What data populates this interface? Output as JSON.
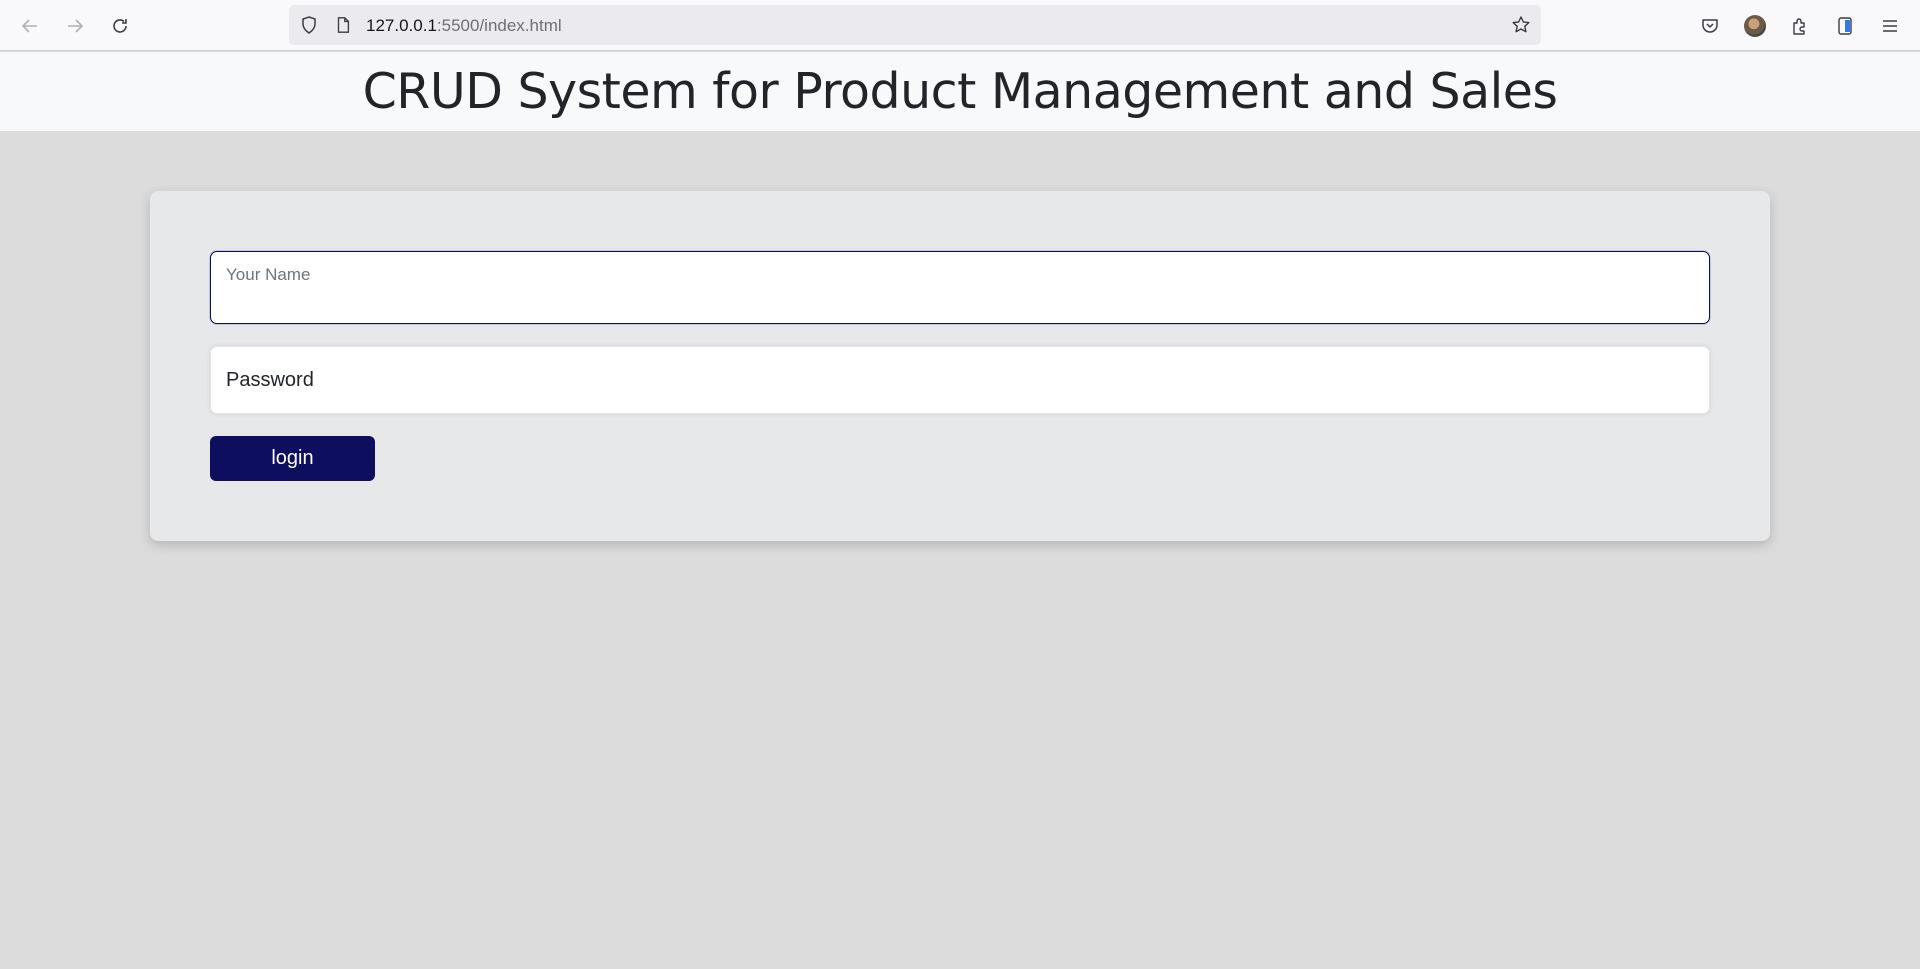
{
  "browser": {
    "url_host": "127.0.0.1",
    "url_path": ":5500/index.html",
    "icons": {
      "back": "arrow-left-icon",
      "forward": "arrow-right-icon",
      "reload": "reload-icon",
      "shield": "shield-icon",
      "page": "page-icon",
      "bookmark": "star-icon",
      "pocket": "pocket-icon",
      "extensions": "puzzle-icon",
      "menu": "hamburger-menu-icon"
    }
  },
  "header": {
    "title": "CRUD System for Product Management and Sales"
  },
  "login_form": {
    "name_label": "Your Name",
    "name_value": "",
    "password_placeholder": "Password",
    "password_value": "",
    "login_label": "login"
  },
  "colors": {
    "accent": "#0d0e5e",
    "background": "#dcdcdc",
    "card": "#e7e8ea",
    "header_bg": "#f8f9fa"
  }
}
